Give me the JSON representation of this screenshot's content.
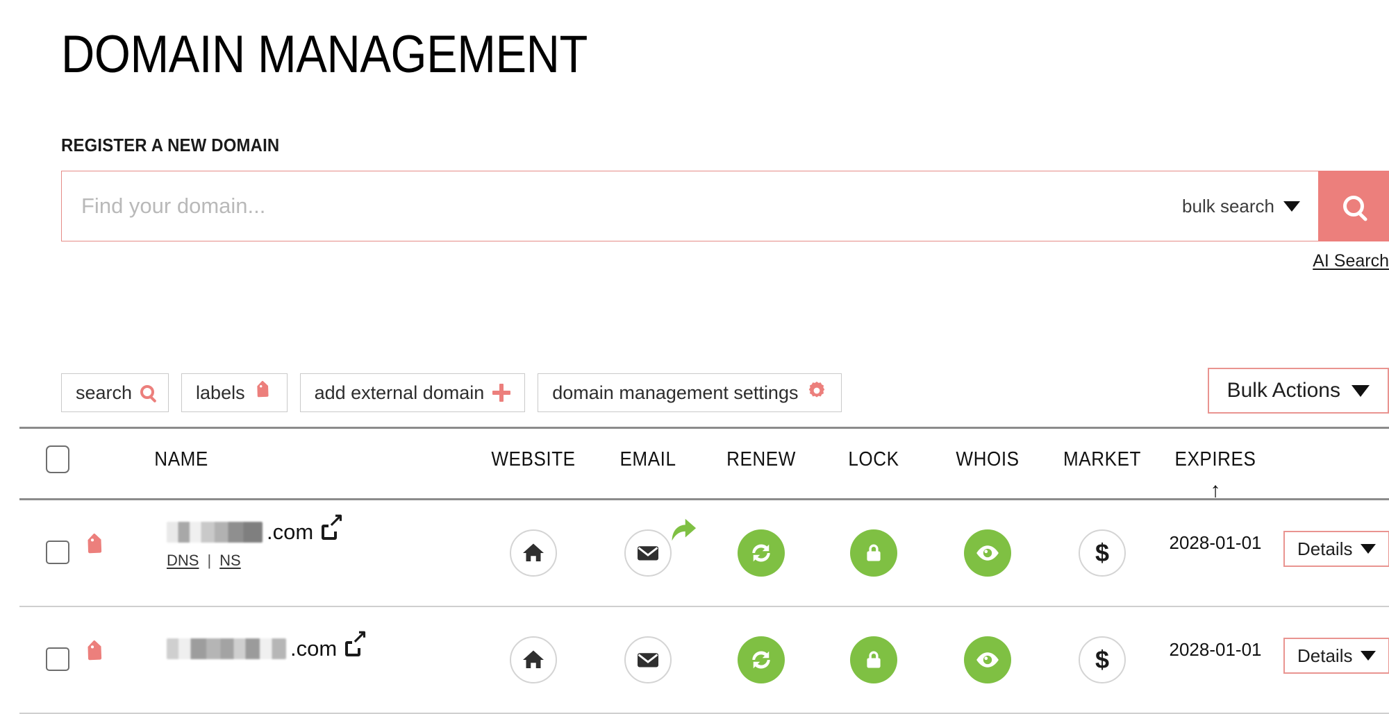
{
  "page": {
    "title": "DOMAIN MANAGEMENT",
    "section_label": "REGISTER A NEW DOMAIN"
  },
  "search": {
    "placeholder": "Find your domain...",
    "value": "",
    "bulk_search_label": "bulk search",
    "search_icon": "search-icon",
    "ai_search_label": "AI Search"
  },
  "toolbar": {
    "buttons": [
      {
        "label": "search",
        "icon": "search-icon"
      },
      {
        "label": "labels",
        "icon": "tag-icon"
      },
      {
        "label": "add external domain",
        "icon": "plus-icon"
      },
      {
        "label": "domain management settings",
        "icon": "gear-icon"
      }
    ],
    "bulk_actions_label": "Bulk Actions",
    "bulk_actions_caret": "chevron-down-icon"
  },
  "table": {
    "columns": [
      {
        "key": "name",
        "label": "NAME"
      },
      {
        "key": "website",
        "label": "WEBSITE"
      },
      {
        "key": "email",
        "label": "EMAIL"
      },
      {
        "key": "renew",
        "label": "RENEW"
      },
      {
        "key": "lock",
        "label": "LOCK"
      },
      {
        "key": "whois",
        "label": "WHOIS"
      },
      {
        "key": "market",
        "label": "MARKET"
      },
      {
        "key": "expires",
        "label": "EXPIRES"
      }
    ],
    "sort": {
      "column": "EXPIRES",
      "direction": "ascending",
      "glyph": "↑"
    },
    "details_label": "Details",
    "rows": [
      {
        "name_redacted": true,
        "tld": ".com",
        "external_link_icon": "external-link-icon",
        "label_icon": "tag-icon",
        "sub_links": [
          "DNS",
          "NS"
        ],
        "sub_link_separator": "|",
        "website": {
          "icon": "home-icon",
          "state": "inactive"
        },
        "email": {
          "icon": "envelope-forward-icon",
          "state": "inactive"
        },
        "renew": {
          "icon": "refresh-icon",
          "state": "active"
        },
        "lock": {
          "icon": "lock-icon",
          "state": "active"
        },
        "whois": {
          "icon": "eye-icon",
          "state": "active"
        },
        "market": {
          "icon": "dollar-icon",
          "state": "inactive"
        },
        "expires": "2028-01-01",
        "details": "Details"
      },
      {
        "name_redacted": true,
        "tld": ".com",
        "external_link_icon": "external-link-icon",
        "label_icon": "tag-icon",
        "sub_links": [],
        "sub_link_separator": "",
        "website": {
          "icon": "home-icon",
          "state": "inactive"
        },
        "email": {
          "icon": "envelope-icon",
          "state": "inactive"
        },
        "renew": {
          "icon": "refresh-icon",
          "state": "active"
        },
        "lock": {
          "icon": "lock-icon",
          "state": "active"
        },
        "whois": {
          "icon": "eye-icon",
          "state": "active"
        },
        "market": {
          "icon": "dollar-icon",
          "state": "inactive"
        },
        "expires": "2028-01-01",
        "details": "Details"
      }
    ]
  },
  "colors": {
    "accent_red": "#ec7f7c",
    "accent_red_border": "#e58b86",
    "active_green": "#7fc043",
    "icon_dark": "#2f2f2f",
    "rule_grey": "#8b8b8b",
    "rule_light": "#cfcfcf",
    "placeholder_grey": "#b9b9b9"
  }
}
